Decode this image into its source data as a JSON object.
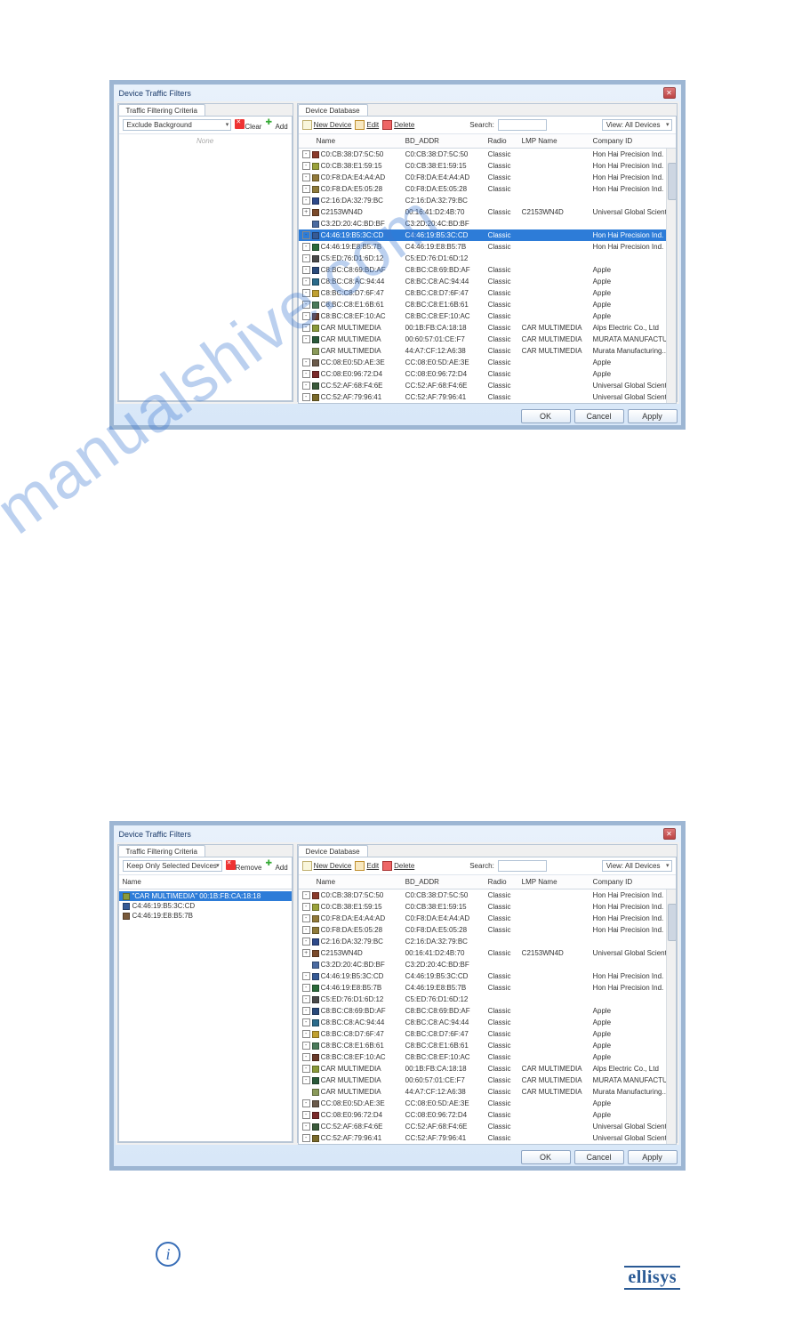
{
  "dlg1": {
    "title": "Device Traffic Filters",
    "left_tab": "Traffic Filtering Criteria",
    "right_tab": "Device Database",
    "left_toolbar": {
      "mode": "Exclude Background",
      "clear": "Clear",
      "add": "Add"
    },
    "left_placeholder": "None",
    "right_toolbar": {
      "new": "New Device",
      "edit": "Edit",
      "delete": "Delete",
      "search_label": "Search:",
      "view": "View: All Devices"
    },
    "headers": {
      "name": "Name",
      "bd": "BD_ADDR",
      "radio": "Radio",
      "lmp": "LMP Name",
      "company": "Company ID"
    },
    "rows": [
      {
        "tw": "-",
        "c": "#8a3a2a",
        "name": "C0:CB:38:D7:5C:50",
        "bd": "C0:CB:38:D7:5C:50",
        "radio": "Classic",
        "lmp": "",
        "co": "Hon Hai Precision Ind. ..."
      },
      {
        "tw": "-",
        "c": "#9aa23a",
        "name": "C0:CB:38:E1:59:15",
        "bd": "C0:CB:38:E1:59:15",
        "radio": "Classic",
        "lmp": "",
        "co": "Hon Hai Precision Ind. ..."
      },
      {
        "tw": "-",
        "c": "#927a3a",
        "name": "C0:F8:DA:E4:A4:AD",
        "bd": "C0:F8:DA:E4:A4:AD",
        "radio": "Classic",
        "lmp": "",
        "co": "Hon Hai Precision Ind. ..."
      },
      {
        "tw": "-",
        "c": "#8e7a3a",
        "name": "C0:F8:DA:E5:05:28",
        "bd": "C0:F8:DA:E5:05:28",
        "radio": "Classic",
        "lmp": "",
        "co": "Hon Hai Precision Ind. ..."
      },
      {
        "tw": "-",
        "c": "#2e4a8a",
        "name": "C2:16:DA:32:79:BC",
        "bd": "C2:16:DA:32:79:BC",
        "radio": "",
        "lmp": "",
        "co": ""
      },
      {
        "tw": "+",
        "c": "#7a4a2a",
        "name": "C2153WN4D",
        "bd": "00:16:41:D2:4B:70",
        "radio": "Classic",
        "lmp": "C2153WN4D",
        "co": "Universal Global Scient..."
      },
      {
        "tw": " ",
        "c": "#4a6aa0",
        "name": "C3:2D:20:4C:BD:BF",
        "bd": "C3:2D:20:4C:BD:BF",
        "radio": "",
        "lmp": "",
        "co": ""
      },
      {
        "tw": "-",
        "c": "#355a95",
        "name": "C4:46:19:B5:3C:CD",
        "bd": "C4:46:19:B5:3C:CD",
        "radio": "Classic",
        "lmp": "",
        "co": "Hon Hai Precision Ind. ...",
        "selected": true
      },
      {
        "tw": "-",
        "c": "#2a6a3a",
        "name": "C4:46:19:E8:B5:7B",
        "bd": "C4:46:19:E8:B5:7B",
        "radio": "Classic",
        "lmp": "",
        "co": "Hon Hai Precision Ind. ..."
      },
      {
        "tw": "-",
        "c": "#4a4a4a",
        "name": "C5:ED:76:D1:6D:12",
        "bd": "C5:ED:76:D1:6D:12",
        "radio": "",
        "lmp": "",
        "co": ""
      },
      {
        "tw": "-",
        "c": "#2a4a7a",
        "name": "C8:BC:C8:69:BD:AF",
        "bd": "C8:BC:C8:69:BD:AF",
        "radio": "Classic",
        "lmp": "",
        "co": "Apple"
      },
      {
        "tw": "-",
        "c": "#2a6a8a",
        "name": "C8:BC:C8:AC:94:44",
        "bd": "C8:BC:C8:AC:94:44",
        "radio": "Classic",
        "lmp": "",
        "co": "Apple"
      },
      {
        "tw": "-",
        "c": "#c0a030",
        "name": "C8:BC:C8:D7:6F:47",
        "bd": "C8:BC:C8:D7:6F:47",
        "radio": "Classic",
        "lmp": "",
        "co": "Apple"
      },
      {
        "tw": "-",
        "c": "#4a7a5a",
        "name": "C8:BC:C8:E1:6B:61",
        "bd": "C8:BC:C8:E1:6B:61",
        "radio": "Classic",
        "lmp": "",
        "co": "Apple"
      },
      {
        "tw": "-",
        "c": "#6a3a2a",
        "name": "C8:BC:C8:EF:10:AC",
        "bd": "C8:BC:C8:EF:10:AC",
        "radio": "Classic",
        "lmp": "",
        "co": "Apple"
      },
      {
        "tw": "-",
        "c": "#8a9a3a",
        "name": "CAR MULTIMEDIA",
        "bd": "00:1B:FB:CA:18:18",
        "radio": "Classic",
        "lmp": "CAR MULTIMEDIA",
        "co": "Alps Electric Co., Ltd"
      },
      {
        "tw": "-",
        "c": "#2a5a3a",
        "name": "CAR MULTIMEDIA",
        "bd": "00:60:57:01:CE:F7",
        "radio": "Classic",
        "lmp": "CAR MULTIMEDIA",
        "co": "MURATA MANUFACTU..."
      },
      {
        "tw": " ",
        "c": "#8a9a5a",
        "name": "CAR MULTIMEDIA",
        "bd": "44:A7:CF:12:A6:38",
        "radio": "Classic",
        "lmp": "CAR MULTIMEDIA",
        "co": "Murata Manufacturing..."
      },
      {
        "tw": "-",
        "c": "#6a5a4a",
        "name": "CC:08:E0:5D:AE:3E",
        "bd": "CC:08:E0:5D:AE:3E",
        "radio": "Classic",
        "lmp": "",
        "co": "Apple"
      },
      {
        "tw": "-",
        "c": "#7a2a2a",
        "name": "CC:08:E0:96:72:D4",
        "bd": "CC:08:E0:96:72:D4",
        "radio": "Classic",
        "lmp": "",
        "co": "Apple"
      },
      {
        "tw": "-",
        "c": "#3a5a3a",
        "name": "CC:52:AF:68:F4:6E",
        "bd": "CC:52:AF:68:F4:6E",
        "radio": "Classic",
        "lmp": "",
        "co": "Universal Global Scient..."
      },
      {
        "tw": "-",
        "c": "#7a6a2a",
        "name": "CC:52:AF:79:96:41",
        "bd": "CC:52:AF:79:96:41",
        "radio": "Classic",
        "lmp": "",
        "co": "Universal Global Scient..."
      }
    ],
    "buttons": {
      "ok": "OK",
      "cancel": "Cancel",
      "apply": "Apply"
    }
  },
  "dlg2": {
    "title": "Device Traffic Filters",
    "left_tab": "Traffic Filtering Criteria",
    "right_tab": "Device Database",
    "left_toolbar": {
      "mode": "Keep Only Selected Devices",
      "remove": "Remove",
      "add": "Add"
    },
    "left_header": "Name",
    "left_rows": [
      {
        "c": "#8a9a3a",
        "t": "\"CAR MULTIMEDIA\" 00:1B:FB:CA:18:18",
        "selected": true
      },
      {
        "c": "#355a95",
        "t": "C4:46:19:B5:3C:CD"
      },
      {
        "c": "#7a5a3a",
        "t": "C4:46:19:E8:B5:7B"
      }
    ],
    "rows": [
      {
        "tw": "-",
        "c": "#8a3a2a",
        "name": "C0:CB:38:D7:5C:50",
        "bd": "C0:CB:38:D7:5C:50",
        "radio": "Classic",
        "lmp": "",
        "co": "Hon Hai Precision Ind. ..."
      },
      {
        "tw": "-",
        "c": "#9aa23a",
        "name": "C0:CB:38:E1:59:15",
        "bd": "C0:CB:38:E1:59:15",
        "radio": "Classic",
        "lmp": "",
        "co": "Hon Hai Precision Ind. ..."
      },
      {
        "tw": "-",
        "c": "#927a3a",
        "name": "C0:F8:DA:E4:A4:AD",
        "bd": "C0:F8:DA:E4:A4:AD",
        "radio": "Classic",
        "lmp": "",
        "co": "Hon Hai Precision Ind. ..."
      },
      {
        "tw": "-",
        "c": "#8e7a3a",
        "name": "C0:F8:DA:E5:05:28",
        "bd": "C0:F8:DA:E5:05:28",
        "radio": "Classic",
        "lmp": "",
        "co": "Hon Hai Precision Ind. ..."
      },
      {
        "tw": "-",
        "c": "#2e4a8a",
        "name": "C2:16:DA:32:79:BC",
        "bd": "C2:16:DA:32:79:BC",
        "radio": "",
        "lmp": "",
        "co": ""
      },
      {
        "tw": "+",
        "c": "#7a4a2a",
        "name": "C2153WN4D",
        "bd": "00:16:41:D2:4B:70",
        "radio": "Classic",
        "lmp": "C2153WN4D",
        "co": "Universal Global Scient..."
      },
      {
        "tw": " ",
        "c": "#4a6aa0",
        "name": "C3:2D:20:4C:BD:BF",
        "bd": "C3:2D:20:4C:BD:BF",
        "radio": "",
        "lmp": "",
        "co": ""
      },
      {
        "tw": "-",
        "c": "#355a95",
        "name": "C4:46:19:B5:3C:CD",
        "bd": "C4:46:19:B5:3C:CD",
        "radio": "Classic",
        "lmp": "",
        "co": "Hon Hai Precision Ind. ..."
      },
      {
        "tw": "-",
        "c": "#2a6a3a",
        "name": "C4:46:19:E8:B5:7B",
        "bd": "C4:46:19:E8:B5:7B",
        "radio": "Classic",
        "lmp": "",
        "co": "Hon Hai Precision Ind. ..."
      },
      {
        "tw": "-",
        "c": "#4a4a4a",
        "name": "C5:ED:76:D1:6D:12",
        "bd": "C5:ED:76:D1:6D:12",
        "radio": "",
        "lmp": "",
        "co": ""
      },
      {
        "tw": "-",
        "c": "#2a4a7a",
        "name": "C8:BC:C8:69:BD:AF",
        "bd": "C8:BC:C8:69:BD:AF",
        "radio": "Classic",
        "lmp": "",
        "co": "Apple"
      },
      {
        "tw": "-",
        "c": "#2a6a8a",
        "name": "C8:BC:C8:AC:94:44",
        "bd": "C8:BC:C8:AC:94:44",
        "radio": "Classic",
        "lmp": "",
        "co": "Apple"
      },
      {
        "tw": "-",
        "c": "#c0a030",
        "name": "C8:BC:C8:D7:6F:47",
        "bd": "C8:BC:C8:D7:6F:47",
        "radio": "Classic",
        "lmp": "",
        "co": "Apple"
      },
      {
        "tw": "-",
        "c": "#4a7a5a",
        "name": "C8:BC:C8:E1:6B:61",
        "bd": "C8:BC:C8:E1:6B:61",
        "radio": "Classic",
        "lmp": "",
        "co": "Apple"
      },
      {
        "tw": "-",
        "c": "#6a3a2a",
        "name": "C8:BC:C8:EF:10:AC",
        "bd": "C8:BC:C8:EF:10:AC",
        "radio": "Classic",
        "lmp": "",
        "co": "Apple"
      },
      {
        "tw": "-",
        "c": "#8a9a3a",
        "name": "CAR MULTIMEDIA",
        "bd": "00:1B:FB:CA:18:18",
        "radio": "Classic",
        "lmp": "CAR MULTIMEDIA",
        "co": "Alps Electric Co., Ltd"
      },
      {
        "tw": "-",
        "c": "#2a5a3a",
        "name": "CAR MULTIMEDIA",
        "bd": "00:60:57:01:CE:F7",
        "radio": "Classic",
        "lmp": "CAR MULTIMEDIA",
        "co": "MURATA MANUFACTU..."
      },
      {
        "tw": " ",
        "c": "#8a9a5a",
        "name": "CAR MULTIMEDIA",
        "bd": "44:A7:CF:12:A6:38",
        "radio": "Classic",
        "lmp": "CAR MULTIMEDIA",
        "co": "Murata Manufacturing..."
      },
      {
        "tw": "-",
        "c": "#6a5a4a",
        "name": "CC:08:E0:5D:AE:3E",
        "bd": "CC:08:E0:5D:AE:3E",
        "radio": "Classic",
        "lmp": "",
        "co": "Apple"
      },
      {
        "tw": "-",
        "c": "#7a2a2a",
        "name": "CC:08:E0:96:72:D4",
        "bd": "CC:08:E0:96:72:D4",
        "radio": "Classic",
        "lmp": "",
        "co": "Apple"
      },
      {
        "tw": "-",
        "c": "#3a5a3a",
        "name": "CC:52:AF:68:F4:6E",
        "bd": "CC:52:AF:68:F4:6E",
        "radio": "Classic",
        "lmp": "",
        "co": "Universal Global Scient..."
      },
      {
        "tw": "-",
        "c": "#7a6a2a",
        "name": "CC:52:AF:79:96:41",
        "bd": "CC:52:AF:79:96:41",
        "radio": "Classic",
        "lmp": "",
        "co": "Universal Global Scient..."
      }
    ]
  },
  "watermark": "manualshive.com",
  "brand": "ellisys"
}
